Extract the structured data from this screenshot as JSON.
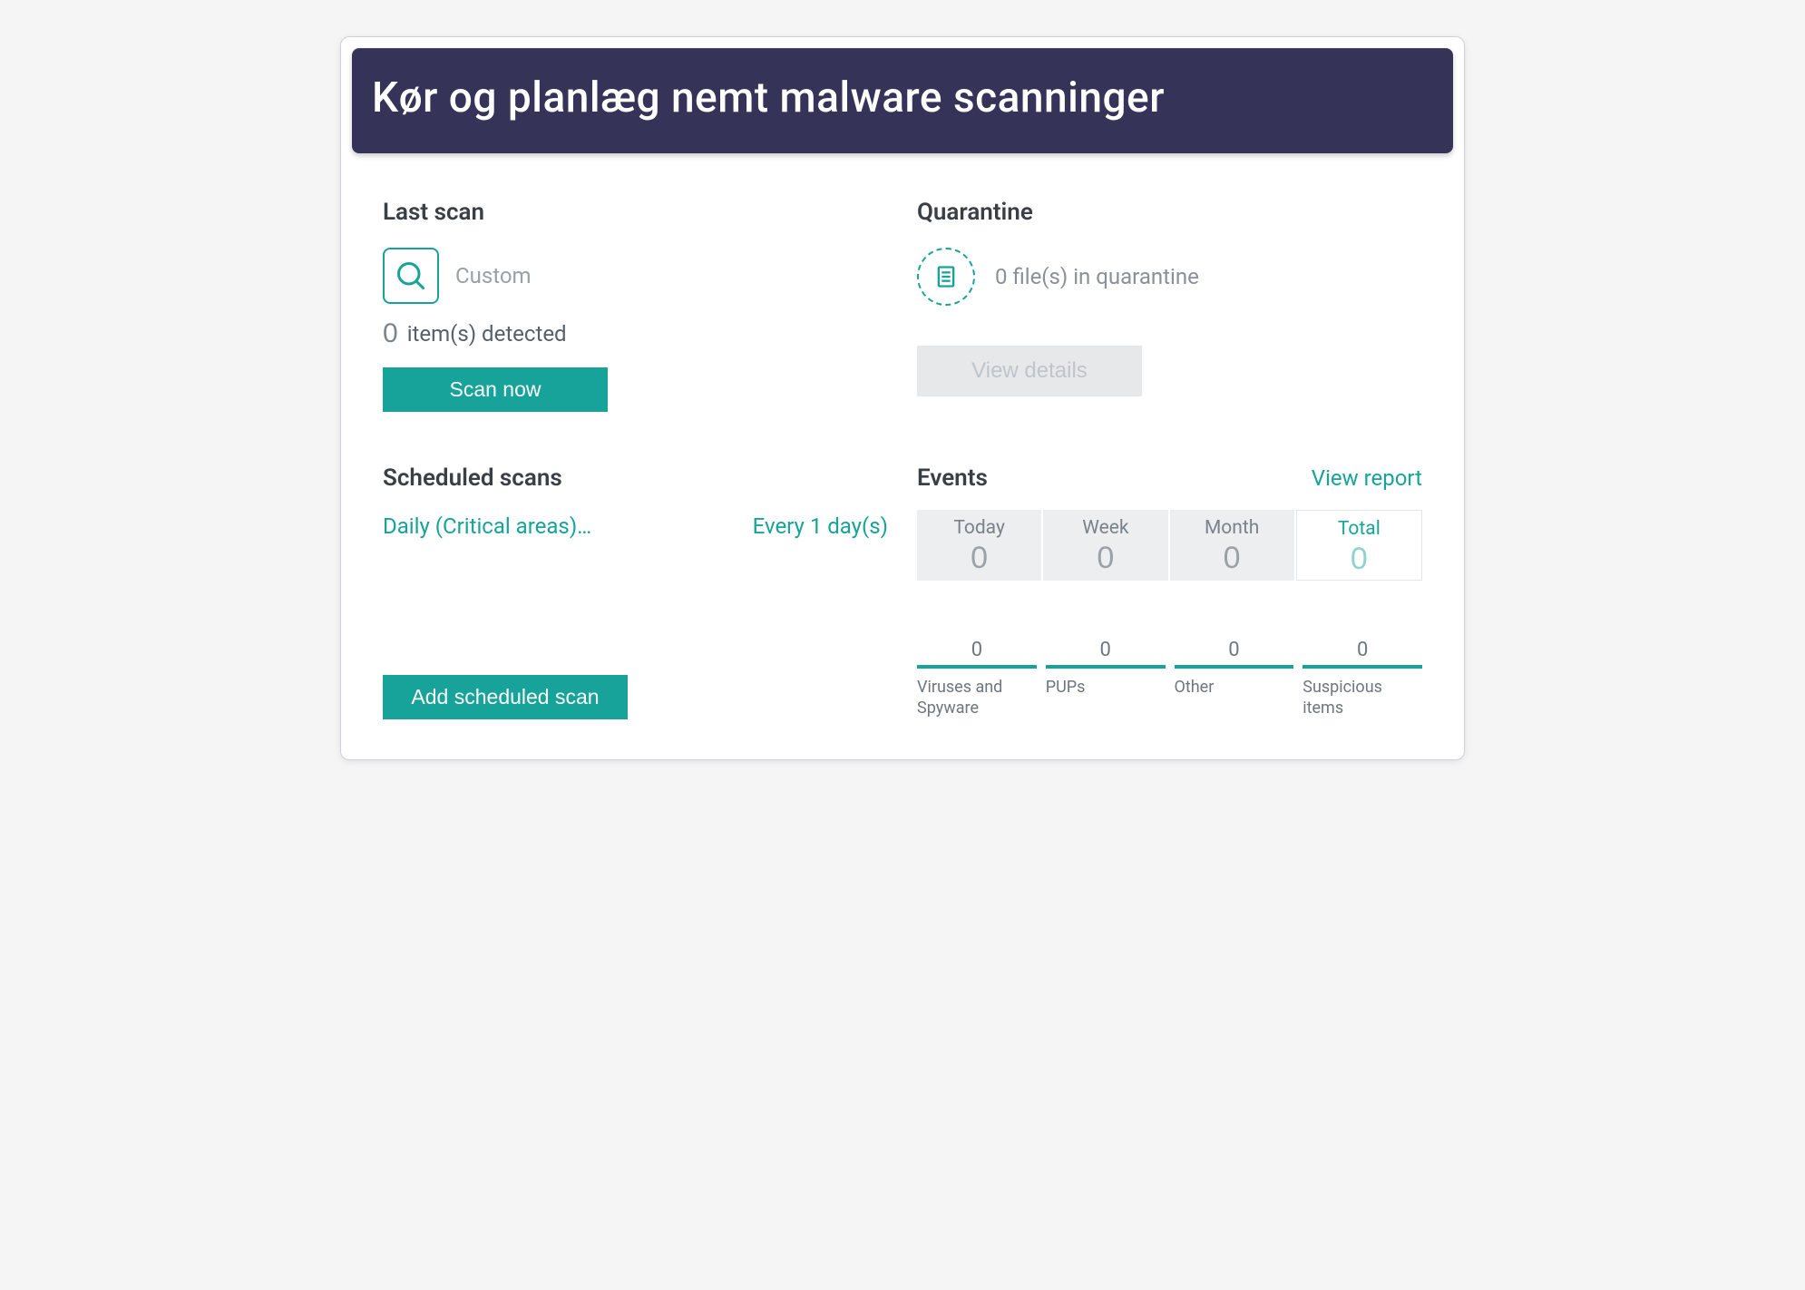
{
  "banner": {
    "title": "Kør og planlæg nemt malware scanninger"
  },
  "lastscan": {
    "title": "Last scan",
    "type": "Custom",
    "detected_count": "0",
    "detected_label": "item(s) detected",
    "scan_button": "Scan now"
  },
  "quarantine": {
    "title": "Quarantine",
    "text": "0 file(s) in quarantine",
    "view_button": "View details"
  },
  "scheduled": {
    "title": "Scheduled scans",
    "item_name": "Daily (Critical areas)…",
    "item_freq": "Every 1 day(s)",
    "add_button": "Add scheduled scan"
  },
  "events": {
    "title": "Events",
    "view_report": "View report",
    "periods": [
      {
        "label": "Today",
        "count": "0"
      },
      {
        "label": "Week",
        "count": "0"
      },
      {
        "label": "Month",
        "count": "0"
      },
      {
        "label": "Total",
        "count": "0"
      }
    ],
    "breakdown": [
      {
        "count": "0",
        "label": "Viruses and Spyware"
      },
      {
        "count": "0",
        "label": "PUPs"
      },
      {
        "count": "0",
        "label": "Other"
      },
      {
        "count": "0",
        "label": "Suspicious items"
      }
    ]
  },
  "colors": {
    "accent": "#17a39a",
    "banner": "#353358"
  }
}
